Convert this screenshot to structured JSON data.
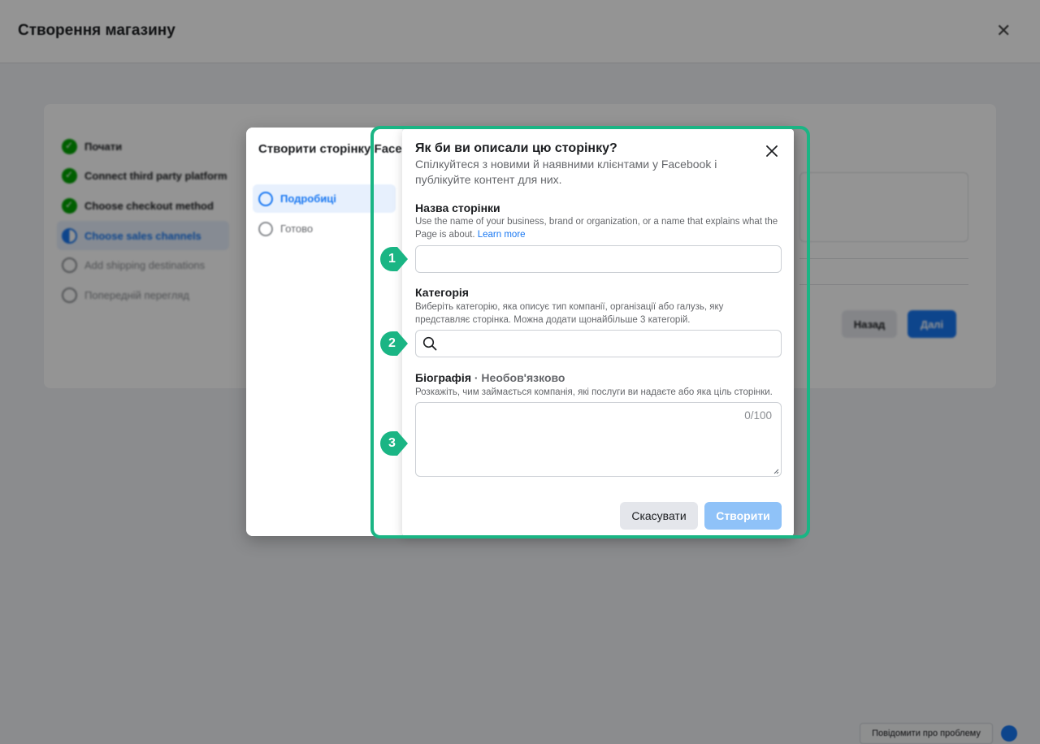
{
  "background": {
    "title": "Створення магазину",
    "close_icon": "close-icon",
    "steps": [
      {
        "label": "Почати",
        "state": "done"
      },
      {
        "label": "Connect third party platform",
        "state": "done"
      },
      {
        "label": "Choose checkout method",
        "state": "done"
      },
      {
        "label": "Choose sales channels",
        "state": "active"
      },
      {
        "label": "Add shipping destinations",
        "state": "pending"
      },
      {
        "label": "Попередній перегляд",
        "state": "pending"
      }
    ],
    "back_label": "Назад",
    "next_label": "Далі",
    "report_label": "Повідомити про проблему"
  },
  "outer_dialog": {
    "title": "Створити сторінку Facebook",
    "steps": [
      {
        "label": "Подробиці",
        "state": "active"
      },
      {
        "label": "Готово",
        "state": "pending"
      }
    ]
  },
  "dialog": {
    "title": "Як би ви описали цю сторінку?",
    "subtitle": "Спілкуйтеся з новими й наявними клієнтами у Facebook і публікуйте контент для них.",
    "page_name": {
      "label": "Назва сторінки",
      "help": "Use the name of your business, brand or organization, or a name that explains what the Page is about.",
      "help_link": "Learn more",
      "value": "",
      "placeholder": ""
    },
    "category": {
      "label": "Категорія",
      "help": "Виберіть категорію, яка описує тип компанії, організації або галузь, яку представляє сторінка. Можна додати щонайбільше 3 категорій.",
      "value": "",
      "placeholder": "",
      "icon": "search-icon"
    },
    "bio": {
      "label": "Біографія",
      "optional": "· Необов'язково",
      "help": "Розкажіть, чим займається компанія, які послуги ви надаєте або яка ціль сторінки.",
      "value": "",
      "counter": "0/100"
    },
    "cancel_label": "Скасувати",
    "create_label": "Створити"
  },
  "annotations": {
    "color": "#1ab584",
    "markers": [
      "1",
      "2",
      "3"
    ]
  }
}
